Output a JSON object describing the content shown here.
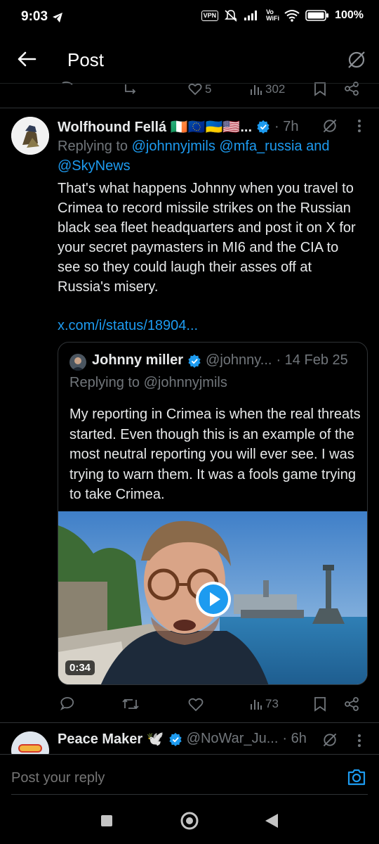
{
  "status_bar": {
    "time": "9:03",
    "vpn": "VPN",
    "wifi_label": "Vo WiFi",
    "battery": "100%"
  },
  "header": {
    "title": "Post"
  },
  "prev_actions": {
    "likes": "5",
    "views": "302"
  },
  "tweet": {
    "author": "Wolfhound Fellá 🇮🇪🇪🇺🇺🇦🇺🇸...",
    "time": "· 7h",
    "replying_prefix": "Replying to ",
    "replying_to": "@johnnyjmils @mfa_russia and",
    "replying_to_2": "@SkyNews",
    "text": "That's what happens Johnny when you travel to Crimea to record missile strikes on the Russian black sea fleet headquarters and post it on X for your secret paymasters in MI6 and the CIA to see so they could laugh their asses off at Russia's misery.",
    "link": "x.com/i/status/18904...",
    "views": "73"
  },
  "quote": {
    "author": "Johnny miller",
    "handle": "@johnny...",
    "date": "· 14 Feb 25",
    "replying_prefix": "Replying to ",
    "replying_to": "@johnnyjmils",
    "text": "My reporting in Crimea is when the real threats started. Even though this is an example of the most neutral reporting you will ever see. I was trying to warn them. It was a fools game trying to take Crimea.",
    "video_duration": "0:34"
  },
  "next_tweet": {
    "author": "Peace Maker 🕊️",
    "handle": "@NoWar_Ju...",
    "time": "· 6h"
  },
  "reply_box": {
    "placeholder": "Post your reply"
  },
  "colors": {
    "accent": "#1d9bf0",
    "muted": "#71767b",
    "border": "#2f3336"
  }
}
